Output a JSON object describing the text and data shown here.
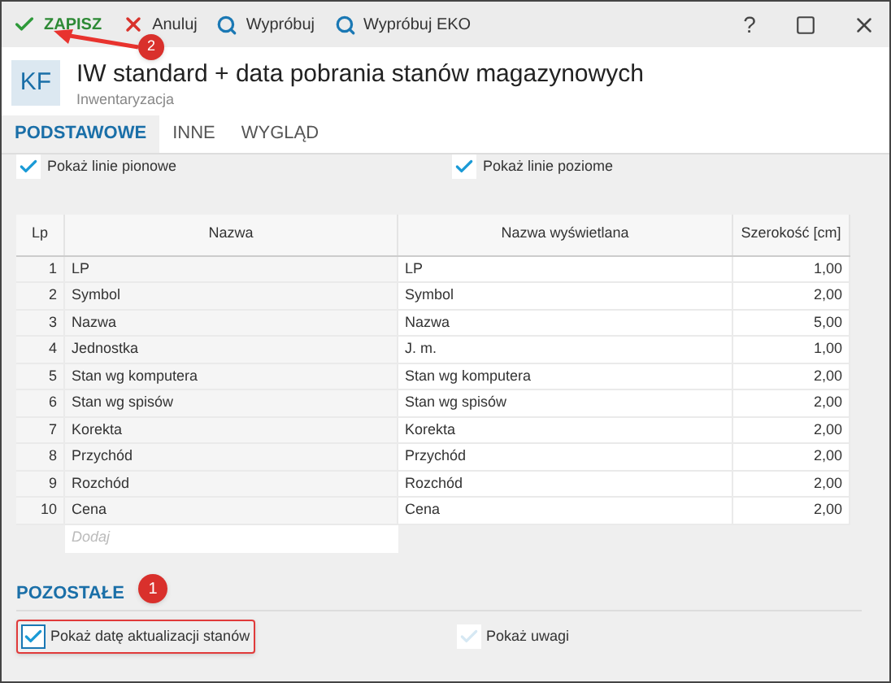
{
  "toolbar": {
    "buttons": [
      {
        "kind": "save",
        "label": "ZAPISZ"
      },
      {
        "kind": "cancel",
        "label": "Anuluj"
      },
      {
        "kind": "search",
        "label": "Wypróbuj"
      },
      {
        "kind": "search",
        "label": "Wypróbuj EKO"
      }
    ],
    "help": "?"
  },
  "header": {
    "avatar": "KF",
    "title": "IW standard + data pobrania stanów magazynowych",
    "subtitle": "Inwentaryzacja"
  },
  "tabs": [
    {
      "label": "PODSTAWOWE",
      "selected": true
    },
    {
      "label": "INNE",
      "selected": false
    },
    {
      "label": "WYGLĄD",
      "selected": false
    }
  ],
  "top_options": [
    {
      "label": "Pokaż linie pionowe",
      "checked": true
    },
    {
      "label": "Pokaż linie poziome",
      "checked": true
    }
  ],
  "table": {
    "columns": [
      "Lp",
      "Nazwa",
      "Nazwa wyświetlana",
      "Szerokość [cm]"
    ],
    "rows": [
      [
        "1",
        "LP",
        "LP",
        "1,00"
      ],
      [
        "2",
        "Symbol",
        "Symbol",
        "2,00"
      ],
      [
        "3",
        "Nazwa",
        "Nazwa",
        "5,00"
      ],
      [
        "4",
        "Jednostka",
        "J. m.",
        "1,00"
      ],
      [
        "5",
        "Stan wg komputera",
        "Stan wg komputera",
        "2,00"
      ],
      [
        "6",
        "Stan wg spisów",
        "Stan wg spisów",
        "2,00"
      ],
      [
        "7",
        "Korekta",
        "Korekta",
        "2,00"
      ],
      [
        "8",
        "Przychód",
        "Przychód",
        "2,00"
      ],
      [
        "9",
        "Rozchód",
        "Rozchód",
        "2,00"
      ],
      [
        "10",
        "Cena",
        "Cena",
        "2,00"
      ]
    ],
    "add_placeholder": "Dodaj"
  },
  "section": {
    "title": "POZOSTAŁE",
    "options": [
      {
        "label": "Pokaż datę aktualizacji stanów",
        "checked": true,
        "highlighted": true
      },
      {
        "label": "Pokaż uwagi",
        "checked": false,
        "highlighted": false
      }
    ]
  },
  "annotations": [
    {
      "label": "2"
    },
    {
      "label": "1"
    }
  ]
}
